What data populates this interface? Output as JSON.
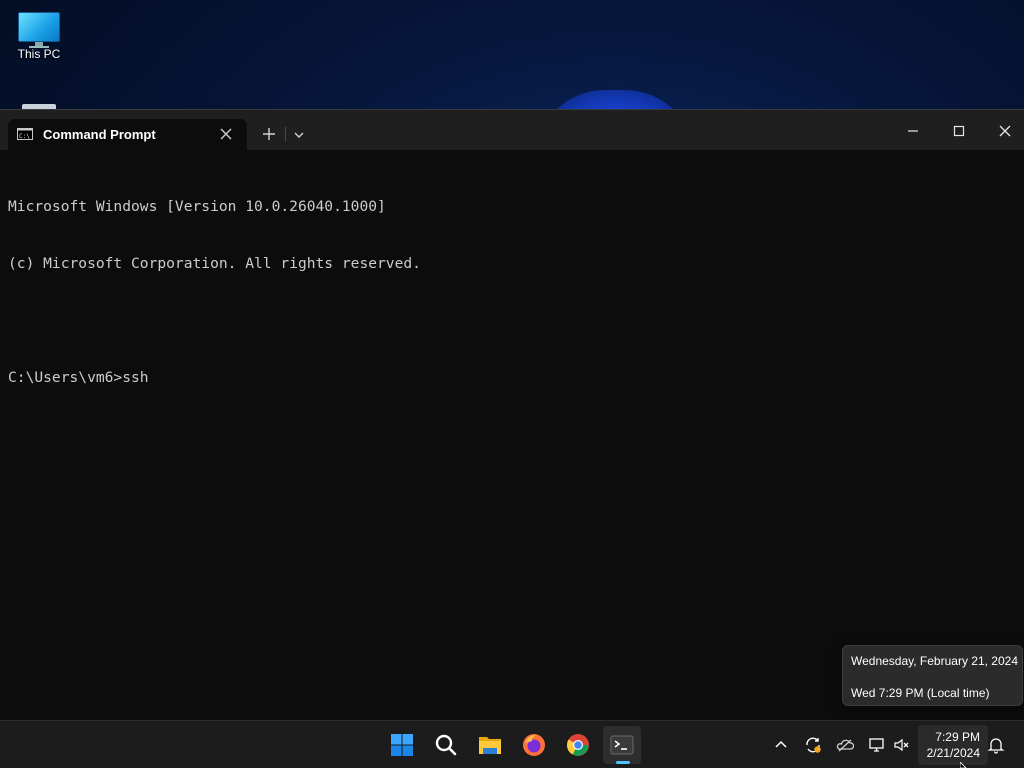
{
  "desktop": {
    "icons": [
      {
        "label": "This PC",
        "icon": "monitor-icon"
      }
    ]
  },
  "window": {
    "tab": {
      "title": "Command Prompt",
      "icon": "cmd-icon"
    },
    "controls": {
      "new_tab_icon": "plus-icon",
      "dropdown_icon": "chevron-down-icon",
      "minimize_icon": "minimize-icon",
      "maximize_icon": "maximize-icon",
      "close_icon": "close-icon"
    },
    "console_lines": [
      "Microsoft Windows [Version 10.0.26040.1000]",
      "(c) Microsoft Corporation. All rights reserved.",
      "",
      "C:\\Users\\vm6>ssh"
    ]
  },
  "tooltip": {
    "date": "Wednesday, February 21, 2024",
    "local_time": "Wed 7:29 PM (Local time)"
  },
  "taskbar": {
    "apps": [
      {
        "name": "Start",
        "icon": "windows-start-icon"
      },
      {
        "name": "Search",
        "icon": "search-icon"
      },
      {
        "name": "File Explorer",
        "icon": "folder-icon"
      },
      {
        "name": "Firefox",
        "icon": "firefox-icon"
      },
      {
        "name": "Chrome",
        "icon": "chrome-icon"
      },
      {
        "name": "Terminal",
        "icon": "terminal-icon",
        "active": true
      }
    ],
    "tray": [
      "chevron-up-icon",
      "sync-icon",
      "onedrive-icon",
      "network-icon",
      "volume-muted-icon"
    ],
    "clock": {
      "time": "7:29 PM",
      "date": "2/21/2024"
    }
  },
  "colors": {
    "console_bg": "#0c0c0c",
    "console_text": "#cccccc",
    "titlebar_bg": "#1f1f1f",
    "taskbar_bg": "#1c1c1c",
    "accent": "#4cc2ff"
  }
}
